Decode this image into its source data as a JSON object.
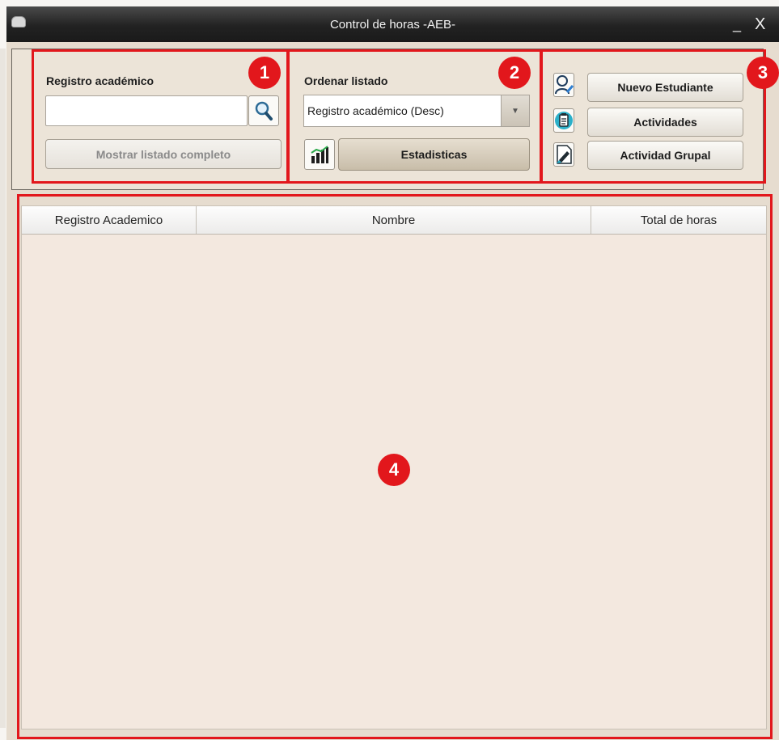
{
  "window": {
    "title": "Control de horas -AEB-",
    "min_glyph": "_",
    "close_glyph": "X"
  },
  "panel1": {
    "label": "Registro académico",
    "search_value": "",
    "show_all_button": "Mostrar listado completo"
  },
  "panel2": {
    "label": "Ordenar listado",
    "sort_selected": "Registro académico (Desc)",
    "stats_button": "Estadisticas"
  },
  "panel3": {
    "buttons": [
      "Nuevo Estudiante",
      "Actividades",
      "Actividad Grupal"
    ]
  },
  "table": {
    "columns": [
      "Registro Academico",
      "Nombre",
      "Total de horas"
    ],
    "rows": []
  },
  "annotations": [
    "1",
    "2",
    "3",
    "4"
  ],
  "icons": {
    "search": "magnifier-icon",
    "stats": "bar-chart-icon",
    "new_student": "user-edit-icon",
    "activities": "clipboard-icon",
    "group_activity": "document-edit-icon"
  },
  "colors": {
    "annotation": "#e2171c",
    "background": "#e6dccf",
    "title_bar": "#222222"
  }
}
